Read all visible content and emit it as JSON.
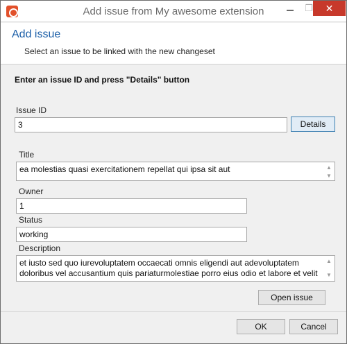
{
  "window": {
    "title": "Add issue from My awesome extension",
    "maximize_glyph": "❐",
    "close_glyph": "✕"
  },
  "header": {
    "title": "Add issue",
    "subtitle": "Select an issue to be linked with the new changeset"
  },
  "instruction": "Enter an issue ID and press \"Details\" button",
  "issue_id": {
    "label": "Issue ID",
    "value": "3",
    "details_button": "Details"
  },
  "details": {
    "title_label": "Title",
    "title_value": "ea molestias quasi exercitationem repellat qui ipsa sit aut",
    "owner_label": "Owner",
    "owner_value": "1",
    "status_label": "Status",
    "status_value": "working",
    "description_label": "Description",
    "description_value": "et iusto sed quo iurevoluptatem occaecati omnis eligendi aut adevoluptatem doloribus vel accusantium quis pariaturmolestiae porro eius odio et labore et velit aut",
    "open_issue_button": "Open issue"
  },
  "footer": {
    "ok_button": "OK",
    "cancel_button": "Cancel"
  },
  "icons": {
    "app": "app-logo-icon",
    "scroll_up": "▲",
    "scroll_down": "▼"
  },
  "colors": {
    "accent": "#1c5fa8",
    "close": "#c7392b",
    "app_icon": "#e2502a"
  }
}
